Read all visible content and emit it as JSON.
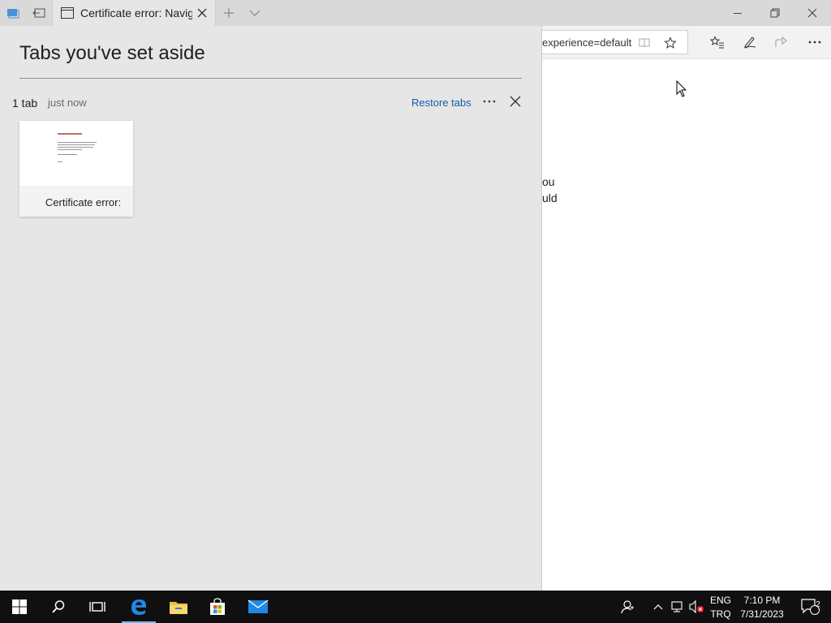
{
  "tab": {
    "title": "Certificate error: Naviga"
  },
  "address_bar": {
    "url_visible": "experience=default"
  },
  "page_fragments": [
    "ou",
    "uld"
  ],
  "set_aside": {
    "heading": "Tabs you've set aside",
    "group": {
      "count_label": "1 tab",
      "time_label": "just now",
      "restore_label": "Restore tabs",
      "thumbnail_label": "Certificate error:"
    }
  },
  "tray": {
    "lang_top": "ENG",
    "lang_bottom": "TRQ",
    "time": "7:10 PM",
    "date": "7/31/2023",
    "notification_count": "2"
  },
  "colors": {
    "accent": "#0078d7",
    "link": "#0f5ea8",
    "taskbar": "#101010",
    "panel": "#e6e6e6"
  },
  "icons": [
    "tabs-aside-icon",
    "set-tabs-aside-icon",
    "page-icon",
    "close-icon",
    "new-tab-icon",
    "tab-preview-chevron-icon",
    "minimize-icon",
    "restore-icon",
    "reading-view-icon",
    "favorite-star-icon",
    "favorites-hub-icon",
    "web-note-pen-icon",
    "share-icon",
    "more-icon",
    "mouse-cursor-icon",
    "windows-start-icon",
    "search-icon",
    "task-view-icon",
    "edge-icon",
    "file-explorer-icon",
    "store-icon",
    "mail-icon",
    "people-icon",
    "chevron-up-icon",
    "network-icon",
    "volume-muted-icon",
    "action-center-icon"
  ]
}
